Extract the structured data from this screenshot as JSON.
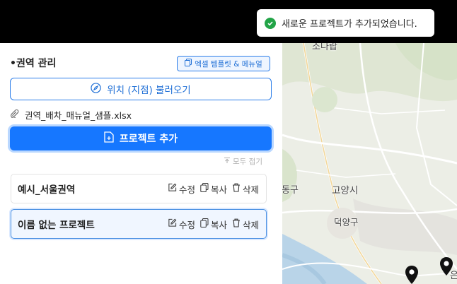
{
  "toast": {
    "message": "새로운 프로젝트가 추가되었습니다.",
    "status_color": "#22a447"
  },
  "panel": {
    "section_title": "•권역 관리",
    "manual_button": "엑셀 템플릿 & 메뉴얼",
    "load_button": "위치 (지점) 불러오기",
    "attached_file": "권역_배차_매뉴얼_샘플.xlsx",
    "add_project_button": "프로젝트 추가",
    "collapse_all": "모두 접기",
    "accent_color": "#1677ff"
  },
  "projects": [
    {
      "name": "예시_서울권역",
      "edit": "수정",
      "copy": "복사",
      "delete": "삭제",
      "selected": false
    },
    {
      "name": "이름 없는 프로젝트",
      "edit": "수정",
      "copy": "복사",
      "delete": "삭제",
      "selected": true
    }
  ],
  "map": {
    "labels": {
      "top": "소나랍",
      "left": "동구",
      "goyang": "고양시",
      "deogyang": "덕양구",
      "right": "은"
    },
    "icons": [
      "map-pin-icon",
      "map-pin-icon"
    ]
  }
}
